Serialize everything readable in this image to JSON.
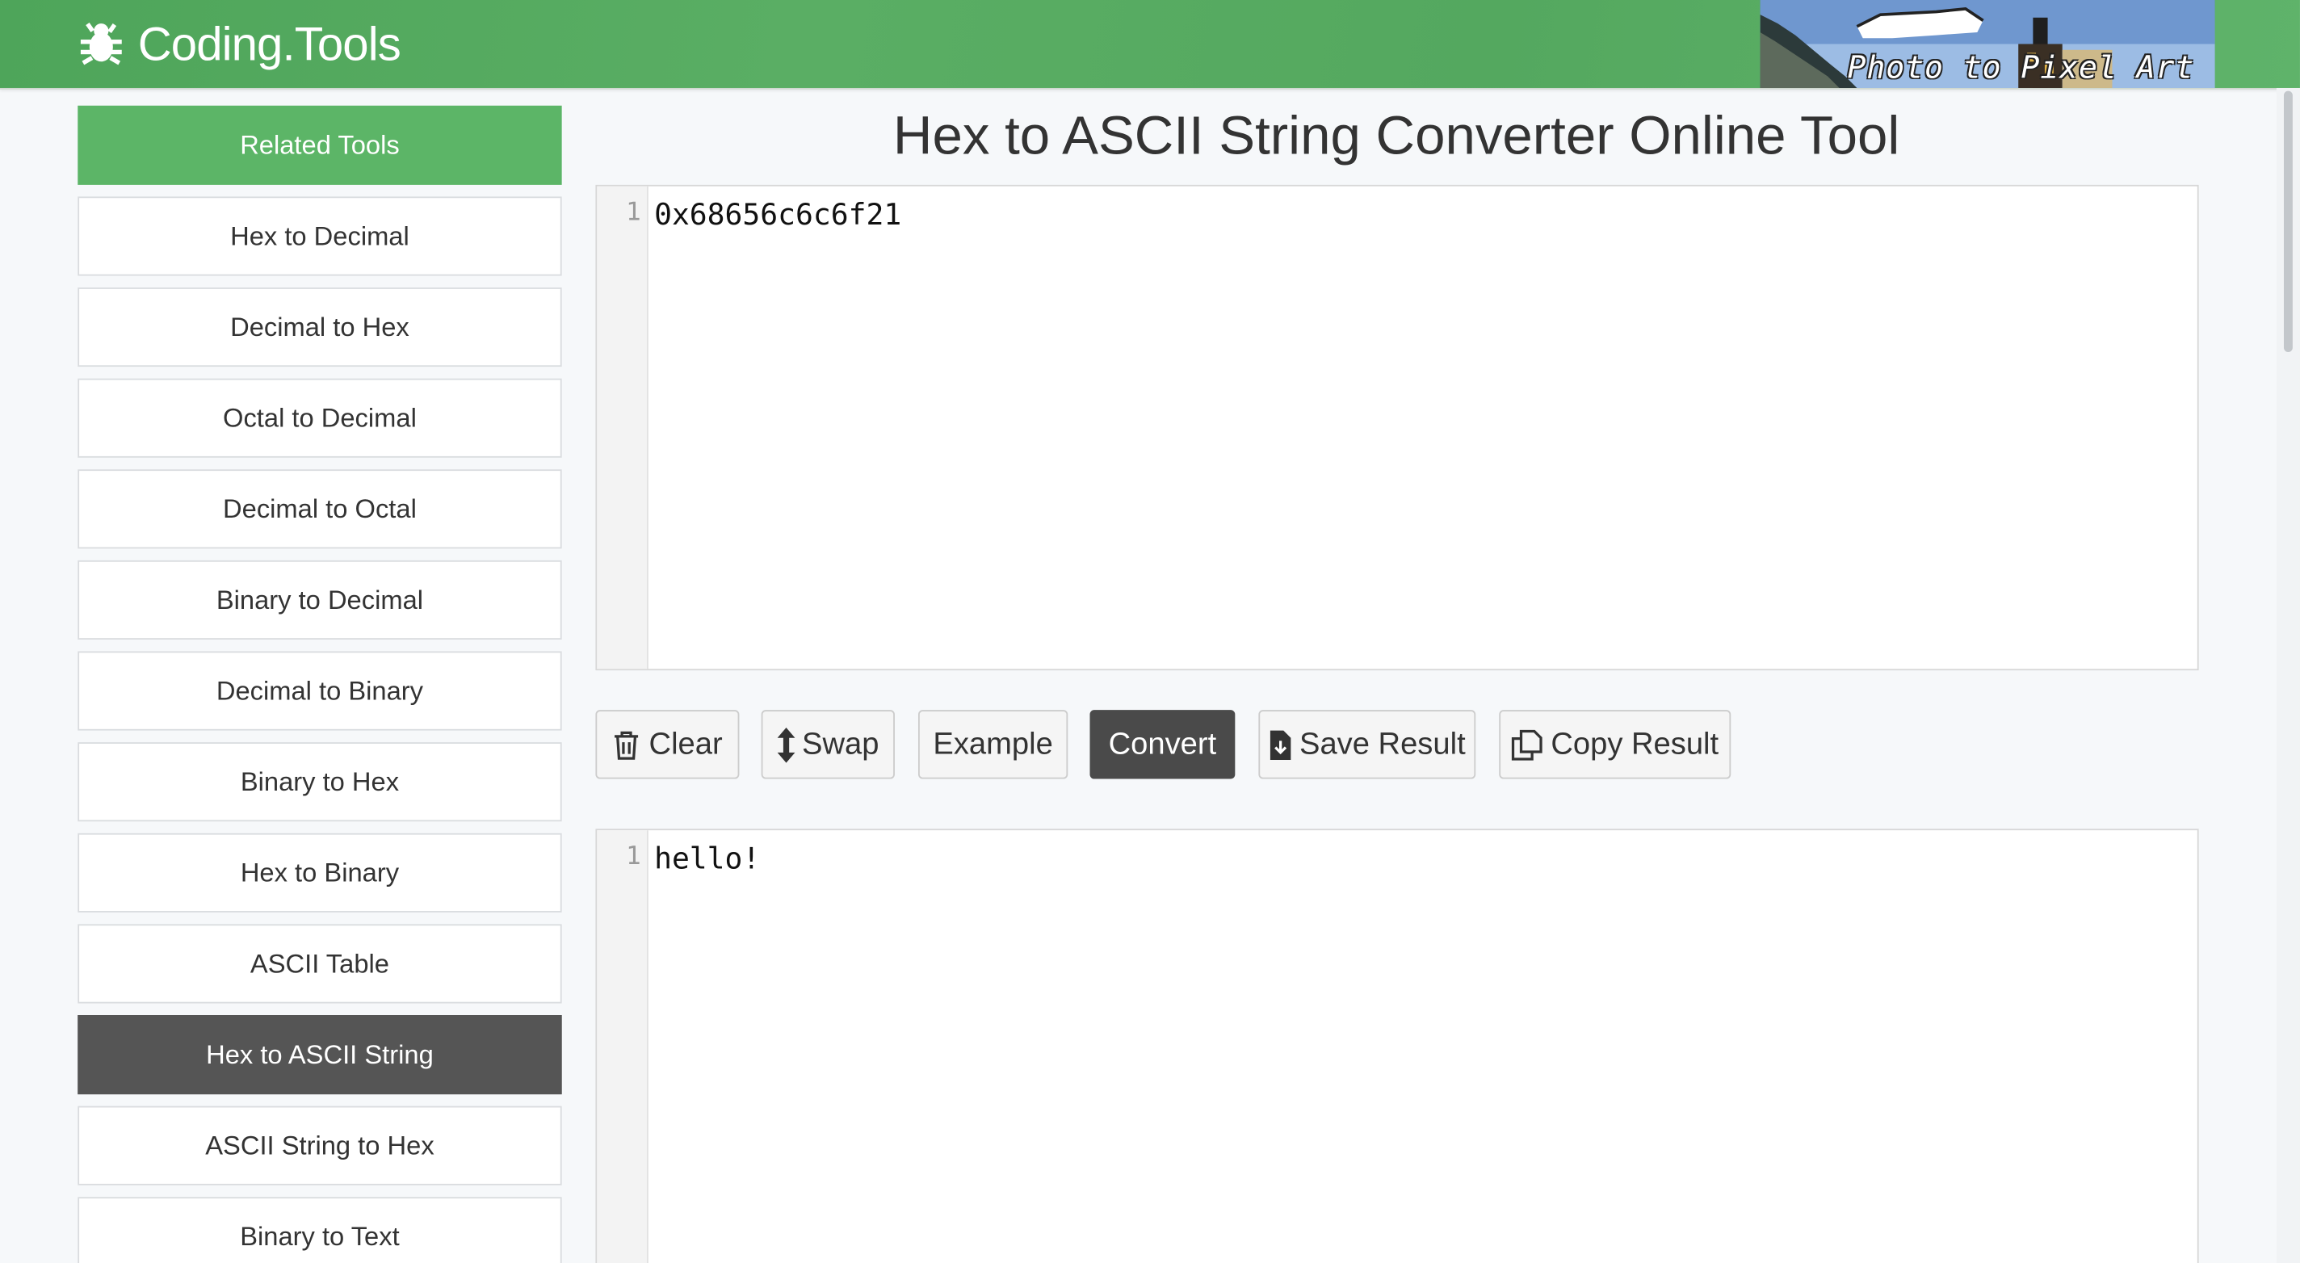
{
  "header": {
    "brand": "Coding.Tools",
    "banner_text": "Photo to Pixel Art"
  },
  "sidebar": {
    "title": "Related Tools",
    "items": [
      {
        "label": "Hex to Decimal",
        "active": false
      },
      {
        "label": "Decimal to Hex",
        "active": false
      },
      {
        "label": "Octal to Decimal",
        "active": false
      },
      {
        "label": "Decimal to Octal",
        "active": false
      },
      {
        "label": "Binary to Decimal",
        "active": false
      },
      {
        "label": "Decimal to Binary",
        "active": false
      },
      {
        "label": "Binary to Hex",
        "active": false
      },
      {
        "label": "Hex to Binary",
        "active": false
      },
      {
        "label": "ASCII Table",
        "active": false
      },
      {
        "label": "Hex to ASCII String",
        "active": true
      },
      {
        "label": "ASCII String to Hex",
        "active": false
      },
      {
        "label": "Binary to Text",
        "active": false
      }
    ]
  },
  "main": {
    "title": "Hex to ASCII String Converter Online Tool",
    "input": {
      "line_number": "1",
      "value": "0x68656c6c6f21"
    },
    "output": {
      "line_number": "1",
      "value": "hello!"
    },
    "buttons": {
      "clear": "Clear",
      "swap": "Swap",
      "example": "Example",
      "convert": "Convert",
      "save": "Save Result",
      "copy": "Copy Result"
    }
  },
  "colors": {
    "header_green": "#5aae64",
    "sidebar_header": "#5cb567",
    "active_item": "#555555",
    "convert_button": "#4a4a4a"
  },
  "icons": {
    "brand": "bug-icon",
    "clear": "trash-icon",
    "swap": "vertical-arrows-icon",
    "save": "file-download-icon",
    "copy": "copy-icon"
  }
}
